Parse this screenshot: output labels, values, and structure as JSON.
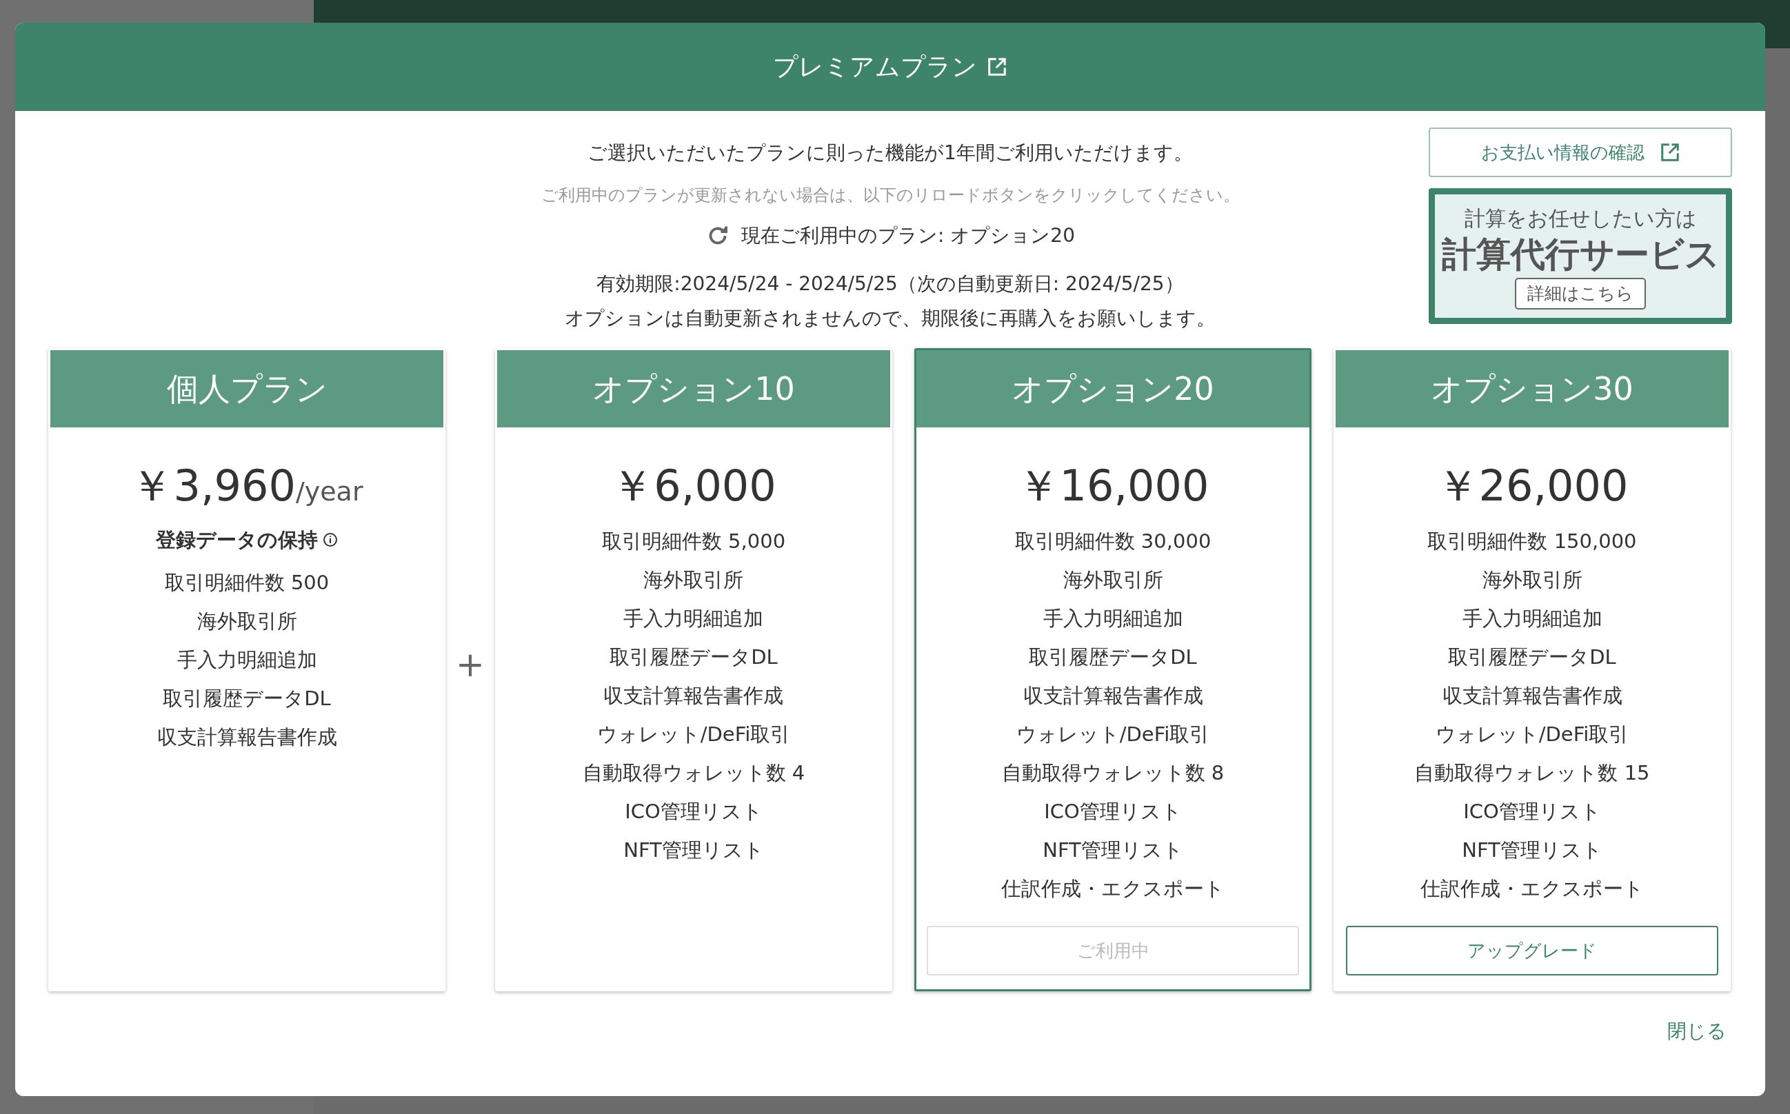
{
  "modal": {
    "title": "プレミアムプラン",
    "intro": "ご選択いただいたプランに則った機能が1年間ご利用いただけます。",
    "note": "ご利用中のプランが更新されない場合は、以下のリロードボタンをクリックしてください。",
    "current_plan": "現在ご利用中のプラン: オプション20",
    "validity": "有効期限:2024/5/24 - 2024/5/25（次の自動更新日: 2024/5/25）",
    "renewal_note": "オプションは自動更新されませんので、期限後に再購入をお願いします。",
    "payment_button": "お支払い情報の確認",
    "service_promo": {
      "lead": "計算をお任せしたい方は",
      "title": "計算代行サービス",
      "button": "詳細はこちら"
    },
    "plans": [
      {
        "name": "個人プラン",
        "price": "￥3,960",
        "period": "/year",
        "retention": "登録データの保持",
        "selected": false,
        "features": [
          "取引明細件数 500",
          "海外取引所",
          "手入力明細追加",
          "取引履歴データDL",
          "収支計算報告書作成"
        ]
      },
      {
        "name": "オプション10",
        "price": "￥6,000",
        "selected": false,
        "features": [
          "取引明細件数 5,000",
          "海外取引所",
          "手入力明細追加",
          "取引履歴データDL",
          "収支計算報告書作成",
          "ウォレット/DeFi取引",
          "自動取得ウォレット数 4",
          "ICO管理リスト",
          "NFT管理リスト"
        ]
      },
      {
        "name": "オプション20",
        "price": "￥16,000",
        "selected": true,
        "features": [
          "取引明細件数 30,000",
          "海外取引所",
          "手入力明細追加",
          "取引履歴データDL",
          "収支計算報告書作成",
          "ウォレット/DeFi取引",
          "自動取得ウォレット数 8",
          "ICO管理リスト",
          "NFT管理リスト",
          "仕訳作成・エクスポート"
        ],
        "button": {
          "label": "ご利用中",
          "disabled": true
        }
      },
      {
        "name": "オプション30",
        "price": "￥26,000",
        "selected": false,
        "features": [
          "取引明細件数 150,000",
          "海外取引所",
          "手入力明細追加",
          "取引履歴データDL",
          "収支計算報告書作成",
          "ウォレット/DeFi取引",
          "自動取得ウォレット数 15",
          "ICO管理リスト",
          "NFT管理リスト",
          "仕訳作成・エクスポート"
        ],
        "button": {
          "label": "アップグレード",
          "disabled": false
        }
      }
    ],
    "plus": "+",
    "close_button": "閉じる"
  }
}
